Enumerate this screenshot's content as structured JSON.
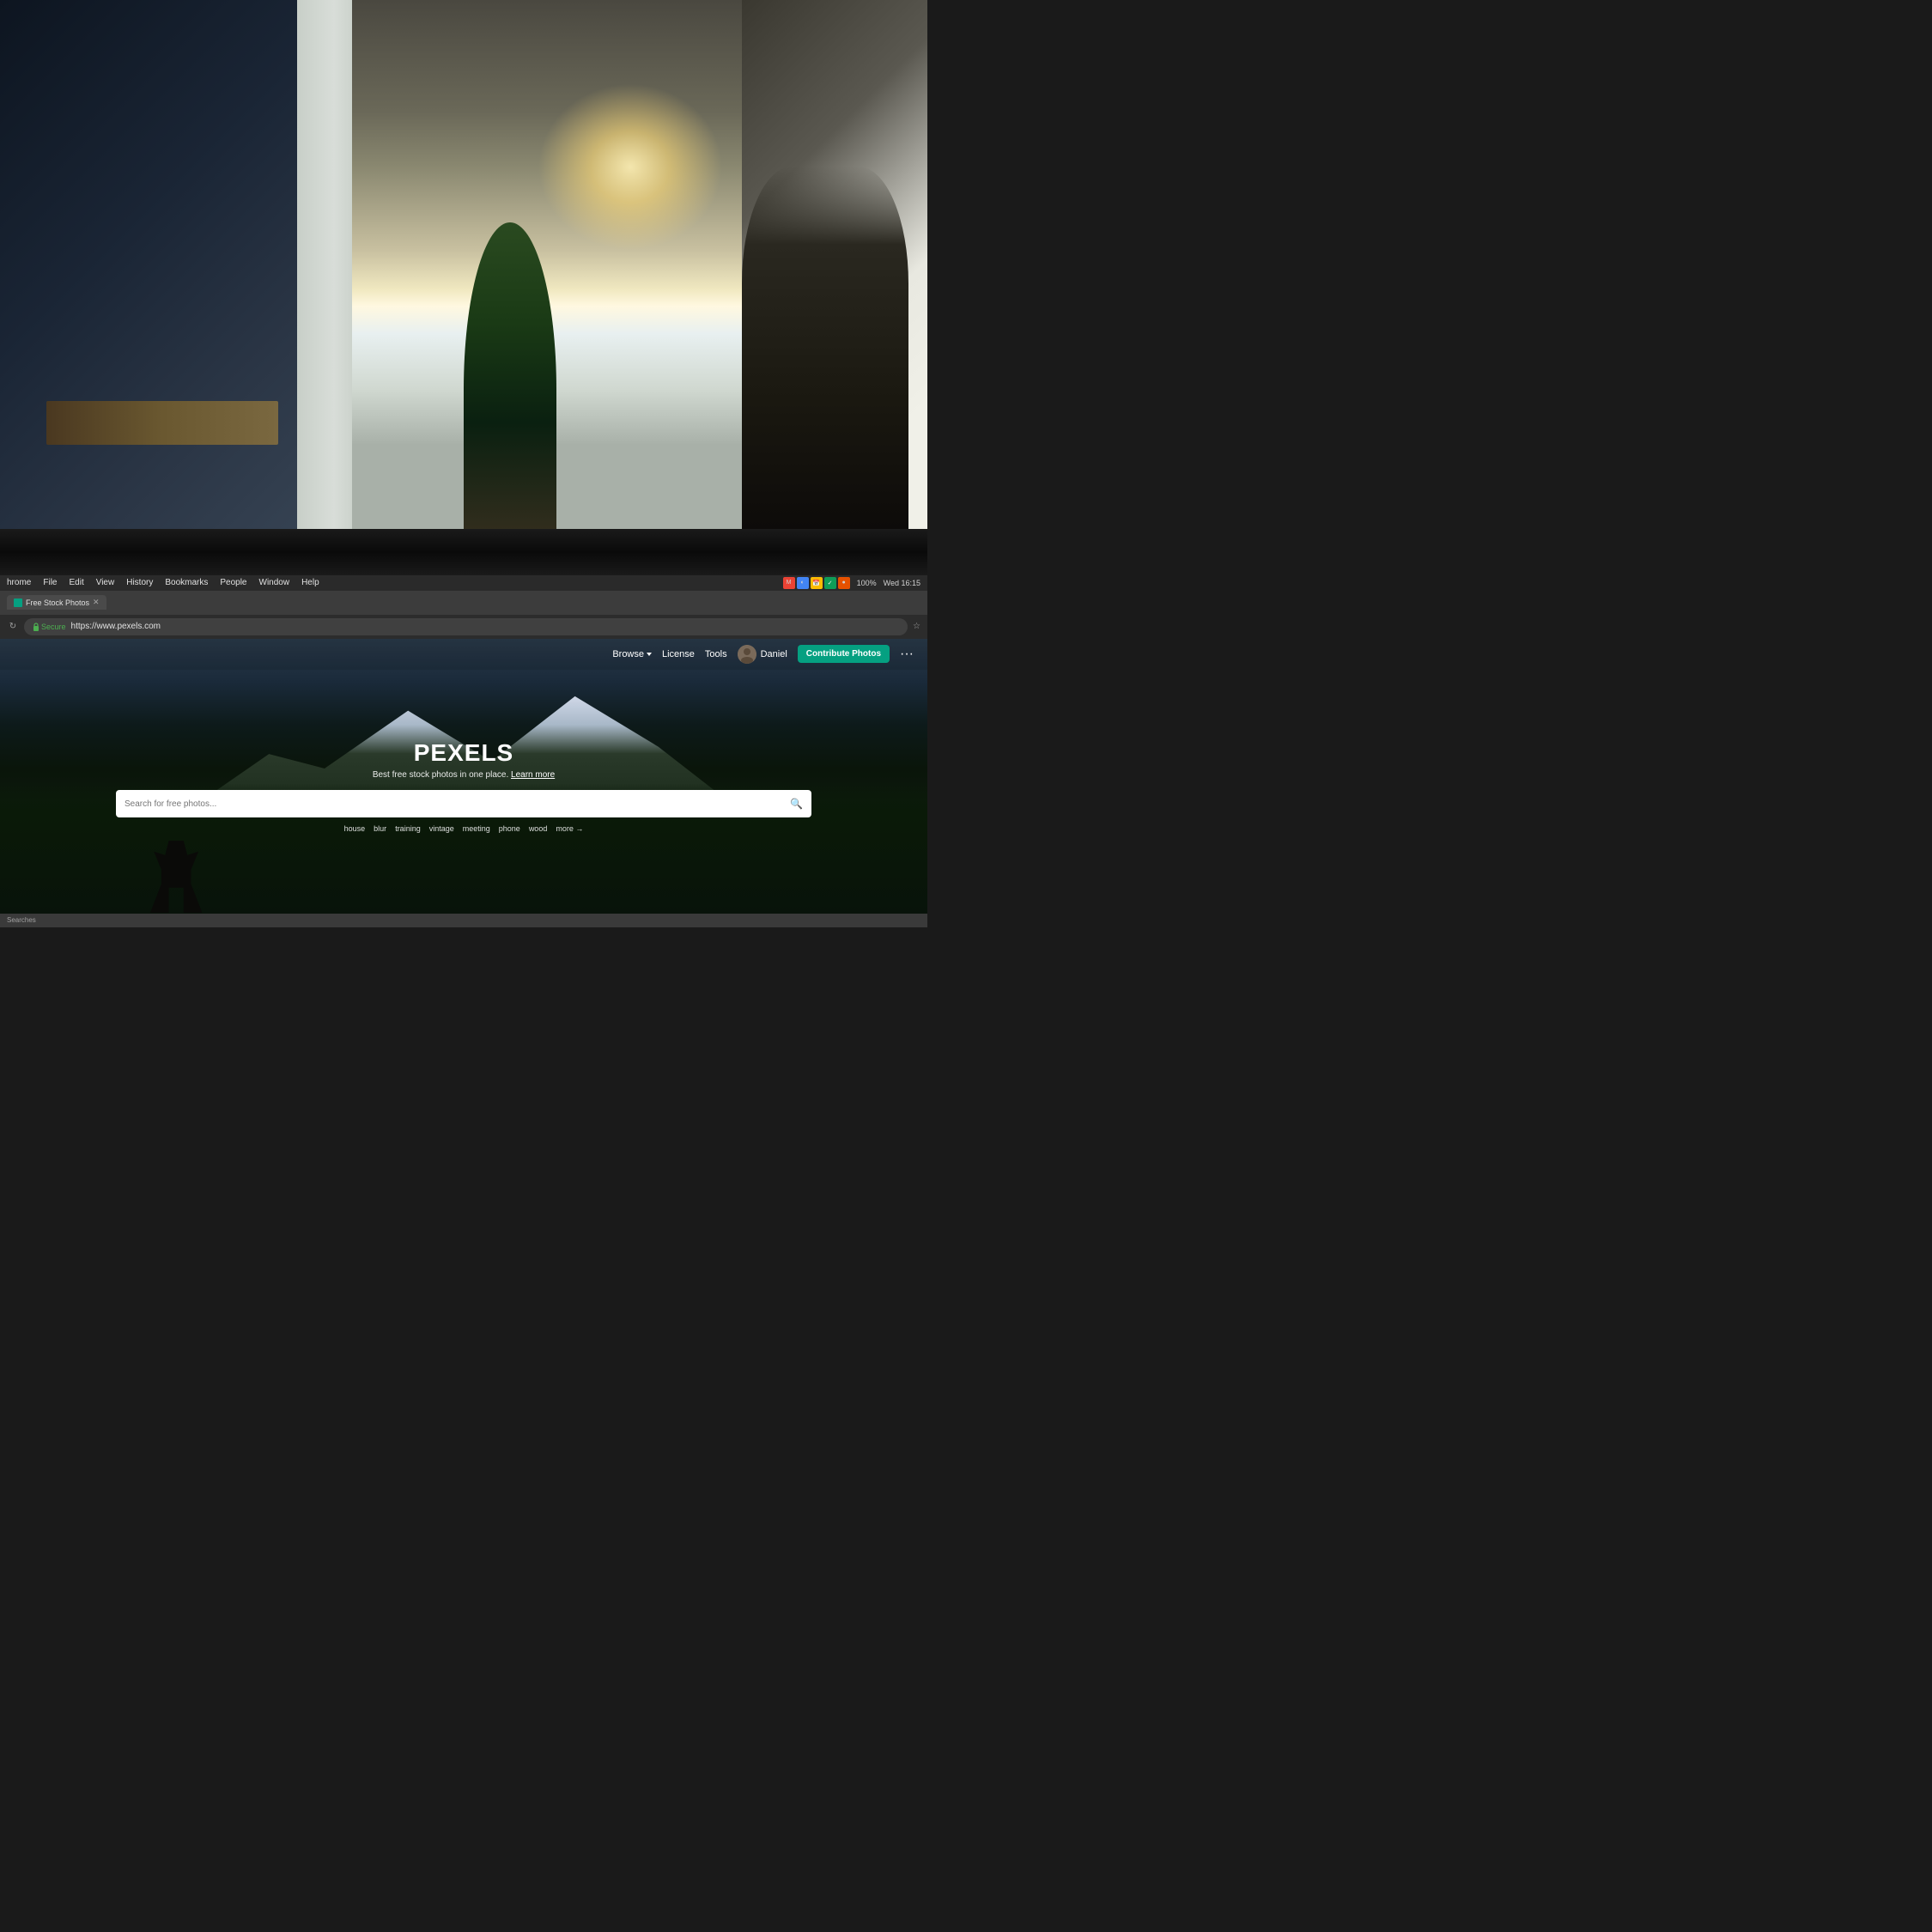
{
  "system_bar": {
    "time": "Wed 16:15",
    "battery": "100%",
    "battery_icon": "🔋"
  },
  "browser": {
    "tab": {
      "title": "Free Stock Photos",
      "favicon_color": "#05a081"
    },
    "menu_items": [
      "hrome",
      "File",
      "Edit",
      "View",
      "History",
      "Bookmarks",
      "People",
      "Window",
      "Help"
    ],
    "address": {
      "secure_label": "Secure",
      "url": "https://www.pexels.com"
    },
    "reload_symbol": "↻",
    "star_symbol": "☆",
    "more_dots": "···"
  },
  "pexels": {
    "nav": {
      "browse_label": "Browse",
      "license_label": "License",
      "tools_label": "Tools",
      "user_name": "Daniel",
      "contribute_label": "Contribute Photos",
      "more_label": "···"
    },
    "hero": {
      "logo": "PEXELS",
      "subtitle": "Best free stock photos in one place.",
      "learn_more": "Learn more",
      "search_placeholder": "Search for free photos...",
      "search_icon": "🔍",
      "tags": [
        "house",
        "blur",
        "training",
        "vintage",
        "meeting",
        "phone",
        "wood"
      ],
      "more_tag": "more →"
    }
  },
  "status_bar": {
    "text": "Searches"
  }
}
